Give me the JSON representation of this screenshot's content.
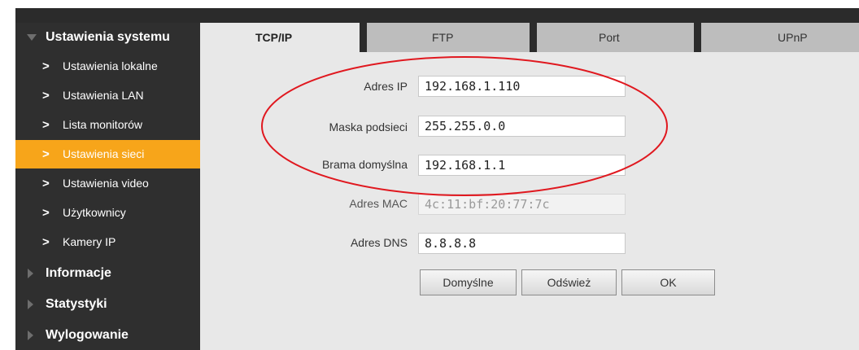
{
  "sidebar": {
    "sections": [
      {
        "label": "Ustawienia systemu"
      },
      {
        "label": "Informacje"
      },
      {
        "label": "Statystyki"
      },
      {
        "label": "Wylogowanie"
      }
    ],
    "items": [
      {
        "label": "Ustawienia lokalne"
      },
      {
        "label": "Ustawienia LAN"
      },
      {
        "label": "Lista monitorów"
      },
      {
        "label": "Ustawienia sieci"
      },
      {
        "label": "Ustawienia video"
      },
      {
        "label": "Użytkownicy"
      },
      {
        "label": "Kamery IP"
      }
    ],
    "active_item": "Ustawienia sieci",
    "chevron": ">"
  },
  "tabs": [
    {
      "label": "TCP/IP",
      "active": true
    },
    {
      "label": "FTP",
      "active": false
    },
    {
      "label": "Port",
      "active": false
    },
    {
      "label": "UPnP",
      "active": false
    }
  ],
  "form": {
    "ip": {
      "label": "Adres IP",
      "value": "192.168.1.110"
    },
    "mask": {
      "label": "Maska podsieci",
      "value": "255.255.0.0"
    },
    "gateway": {
      "label": "Brama domyślna",
      "value": "192.168.1.1"
    },
    "mac": {
      "label": "Adres MAC",
      "value": "4c:11:bf:20:77:7c",
      "disabled": true
    },
    "dns": {
      "label": "Adres DNS",
      "value": "8.8.8.8"
    }
  },
  "buttons": {
    "defaults": "Domyślne",
    "refresh": "Odśwież",
    "ok": "OK"
  },
  "colors": {
    "sidebar_bg": "#2f2f2f",
    "active_item": "#f7a51a",
    "panel_bg": "#e8e8e8",
    "annotation": "#e0181f"
  },
  "annotation": {
    "shape": "ellipse",
    "color": "red",
    "highlights": "ip-mask-gateway"
  }
}
